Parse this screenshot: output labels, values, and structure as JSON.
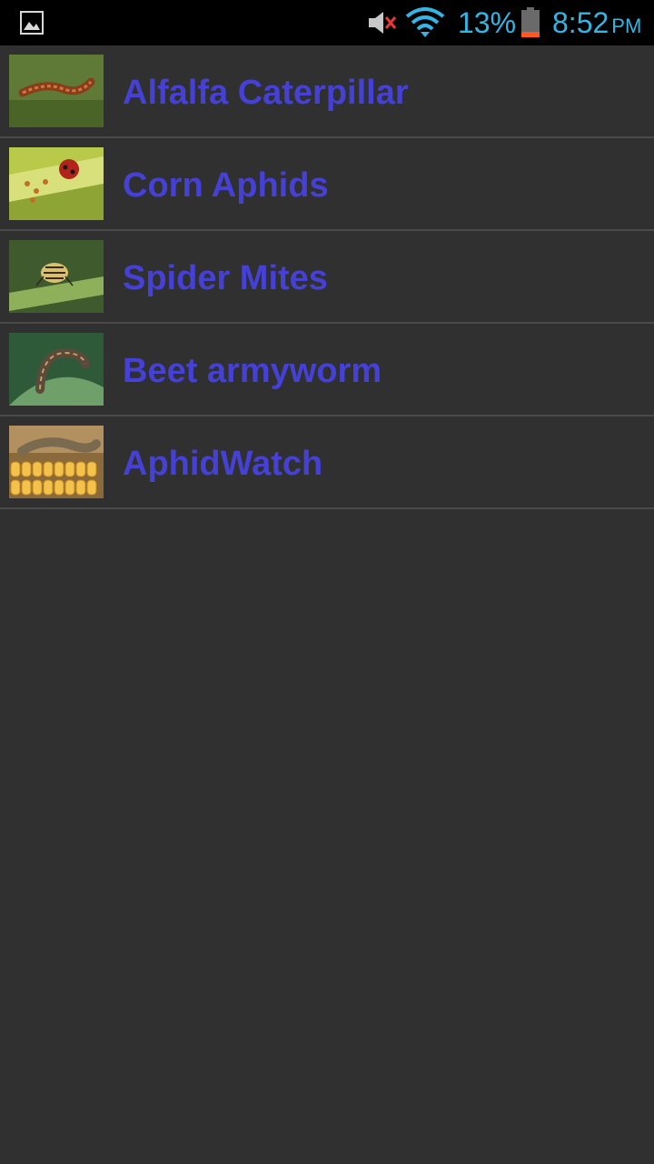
{
  "status_bar": {
    "battery_percent": "13%",
    "time": "8:52",
    "am_pm": "PM",
    "icons": [
      "gallery-notification-icon",
      "mute-icon",
      "wifi-icon",
      "battery-icon"
    ],
    "accent_color": "#33b5e5"
  },
  "pest_list": {
    "items": [
      {
        "label": "Alfalfa Caterpillar",
        "thumbnail": "alfalfa-caterpillar-thumbnail"
      },
      {
        "label": "Corn Aphids",
        "thumbnail": "corn-aphids-thumbnail"
      },
      {
        "label": "Spider Mites",
        "thumbnail": "spider-mites-thumbnail"
      },
      {
        "label": "Beet armyworm",
        "thumbnail": "beet-armyworm-thumbnail"
      },
      {
        "label": "AphidWatch",
        "thumbnail": "aphidwatch-thumbnail"
      }
    ],
    "label_color": "#4540d6"
  }
}
